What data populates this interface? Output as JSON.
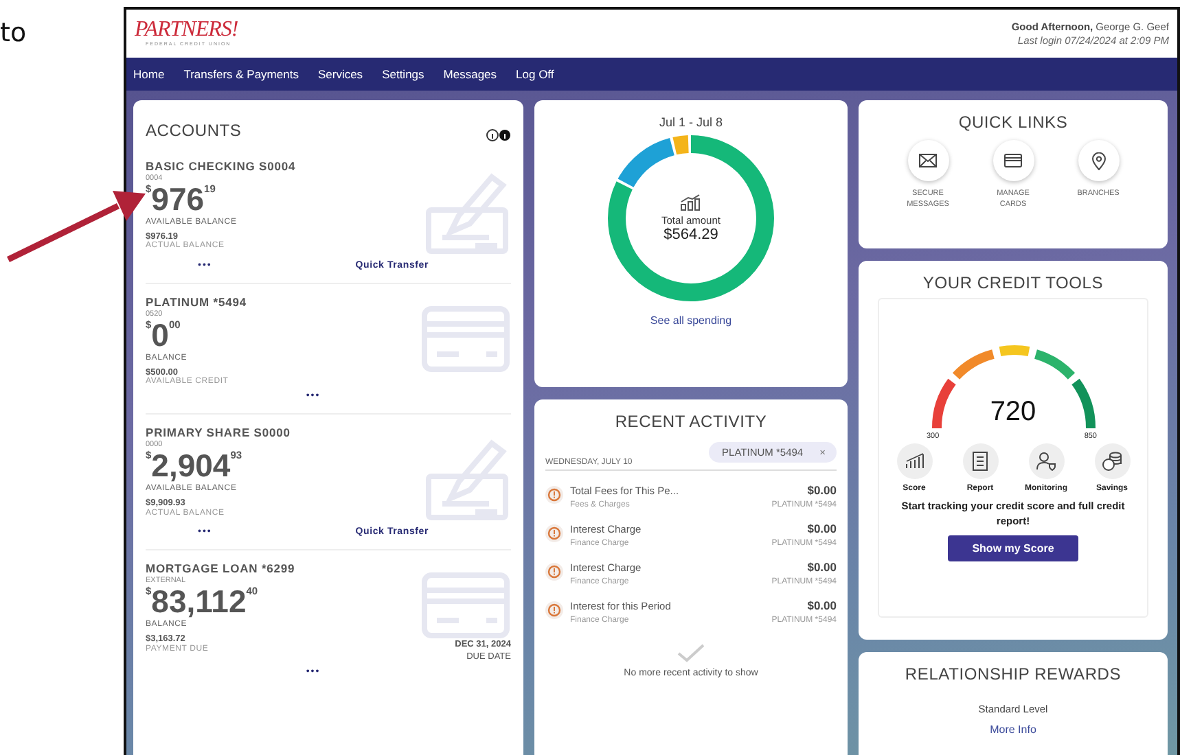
{
  "doc_text": "to",
  "header": {
    "logo": "PARTNERS!",
    "logo_sub": "FEDERAL CREDIT UNION",
    "greeting": "Good Afternoon,",
    "user": "George G. Geef",
    "last_login": "Last login 07/24/2024 at 2:09 PM"
  },
  "nav": [
    "Home",
    "Transfers & Payments",
    "Services",
    "Settings",
    "Messages",
    "Log Off"
  ],
  "accounts": {
    "title": "ACCOUNTS",
    "items": [
      {
        "name": "BASIC CHECKING S0004",
        "number": "0004",
        "kind": "check",
        "currency": "$",
        "whole": "976",
        "cents": "19",
        "balance_label": "AVAILABLE BALANCE",
        "secondary_amount": "$976.19",
        "secondary_label": "ACTUAL BALANCE",
        "more": "•••",
        "action": "Quick Transfer"
      },
      {
        "name": "PLATINUM *5494",
        "number": "0520",
        "kind": "card",
        "currency": "$",
        "whole": "0",
        "cents": "00",
        "balance_label": "BALANCE",
        "secondary_amount": "$500.00",
        "secondary_label": "AVAILABLE CREDIT",
        "more": "•••"
      },
      {
        "name": "PRIMARY SHARE S0000",
        "number": "0000",
        "kind": "check",
        "currency": "$",
        "whole": "2,904",
        "cents": "93",
        "balance_label": "AVAILABLE BALANCE",
        "secondary_amount": "$9,909.93",
        "secondary_label": "ACTUAL BALANCE",
        "more": "•••",
        "action": "Quick Transfer"
      },
      {
        "name": "MORTGAGE LOAN *6299",
        "number": "EXTERNAL",
        "kind": "card",
        "currency": "$",
        "whole": "83,112",
        "cents": "40",
        "balance_label": "BALANCE",
        "secondary_amount": "$3,163.72",
        "secondary_label": "PAYMENT DUE",
        "due_date": "DEC 31, 2024",
        "due_label": "DUE DATE",
        "more": "•••"
      }
    ]
  },
  "spending": {
    "period": "Jul 1 - Jul 8",
    "total_label": "Total amount",
    "total": "$564.29",
    "link": "See all spending"
  },
  "activity": {
    "title": "RECENT ACTIVITY",
    "filter": "PLATINUM *5494",
    "filter_close": "×",
    "date": "WEDNESDAY, JULY 10",
    "items": [
      {
        "title": "Total Fees for This Pe...",
        "category": "Fees & Charges",
        "amount": "$0.00",
        "account": "PLATINUM *5494"
      },
      {
        "title": "Interest Charge",
        "category": "Finance Charge",
        "amount": "$0.00",
        "account": "PLATINUM *5494"
      },
      {
        "title": "Interest Charge",
        "category": "Finance Charge",
        "amount": "$0.00",
        "account": "PLATINUM *5494"
      },
      {
        "title": "Interest for this Period",
        "category": "Finance Charge",
        "amount": "$0.00",
        "account": "PLATINUM *5494"
      }
    ],
    "end_text": "No more recent activity to show"
  },
  "quick_links": {
    "title": "QUICK LINKS",
    "items": [
      {
        "label": "SECURE MESSAGES",
        "kind": "mail"
      },
      {
        "label": "MANAGE CARDS",
        "kind": "card"
      },
      {
        "label": "BRANCHES",
        "kind": "pin"
      }
    ]
  },
  "credit": {
    "title": "YOUR CREDIT TOOLS",
    "score": "720",
    "min": "300",
    "max": "850",
    "features": [
      {
        "label": "Score",
        "kind": "chart"
      },
      {
        "label": "Report",
        "kind": "report"
      },
      {
        "label": "Monitoring",
        "kind": "person"
      },
      {
        "label": "Savings",
        "kind": "coins"
      }
    ],
    "message": "Start tracking your credit score and full credit report!",
    "button": "Show my Score"
  },
  "rewards": {
    "title": "RELATIONSHIP REWARDS",
    "level": "Standard Level",
    "link": "More Info"
  }
}
